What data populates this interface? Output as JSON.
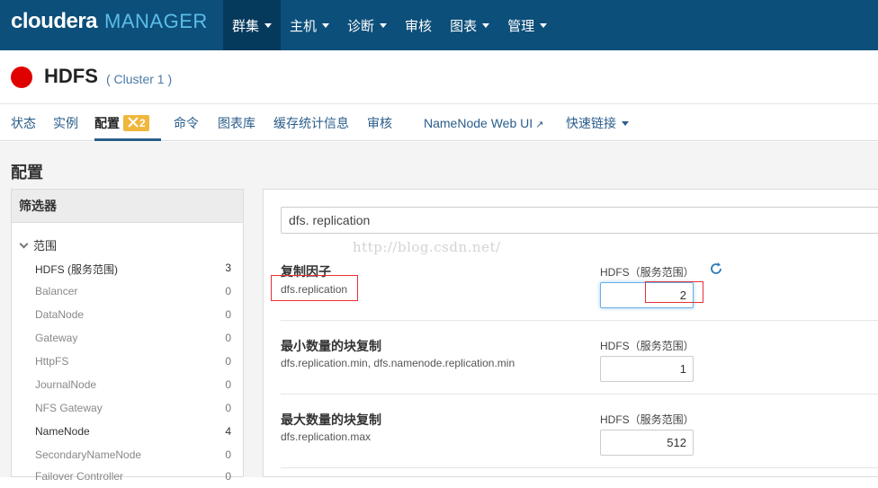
{
  "brand": {
    "word1": "cloudera",
    "word2": "MANAGER"
  },
  "nav": [
    {
      "label": "群集",
      "dropdown": true,
      "active": true
    },
    {
      "label": "主机",
      "dropdown": true
    },
    {
      "label": "诊断",
      "dropdown": true
    },
    {
      "label": "审核",
      "dropdown": false
    },
    {
      "label": "图表",
      "dropdown": true
    },
    {
      "label": "管理",
      "dropdown": true
    }
  ],
  "service": {
    "name": "HDFS",
    "cluster": "( Cluster 1 )",
    "status_color": "#e00000"
  },
  "subtabs": {
    "status": "状态",
    "instances": "实例",
    "config": "配置",
    "config_badge": "2",
    "commands": "命令",
    "charts": "图表库",
    "cache": "缓存统计信息",
    "audit": "审核",
    "namenode_ui": "NameNode Web UI",
    "quick_links": "快速链接"
  },
  "page_title": "配置",
  "filter": {
    "header": "筛选器",
    "group": "范围",
    "items": [
      {
        "label": "HDFS (服务范围)",
        "count": "3"
      },
      {
        "label": "Balancer",
        "count": "0"
      },
      {
        "label": "DataNode",
        "count": "0"
      },
      {
        "label": "Gateway",
        "count": "0"
      },
      {
        "label": "HttpFS",
        "count": "0"
      },
      {
        "label": "JournalNode",
        "count": "0"
      },
      {
        "label": "NFS Gateway",
        "count": "0"
      },
      {
        "label": "NameNode",
        "count": "4"
      },
      {
        "label": "SecondaryNameNode",
        "count": "0"
      },
      {
        "label": "Failover Controller",
        "count": "0"
      }
    ]
  },
  "search": {
    "value": "dfs. replication"
  },
  "watermark": "http://blog.csdn.net/",
  "properties": [
    {
      "name": "复制因子",
      "key": "dfs.replication",
      "scope": "HDFS（服务范围）",
      "value": "2"
    },
    {
      "name": "最小数量的块复制",
      "key": "dfs.replication.min, dfs.namenode.replication.min",
      "scope": "HDFS（服务范围）",
      "value": "1"
    },
    {
      "name": "最大数量的块复制",
      "key": "dfs.replication.max",
      "scope": "HDFS（服务范围）",
      "value": "512"
    }
  ],
  "colors": {
    "topbar": "#0c4f7a",
    "accent": "#2a5d8a",
    "badge": "#f0b73c",
    "highlight": "#e8303a"
  }
}
